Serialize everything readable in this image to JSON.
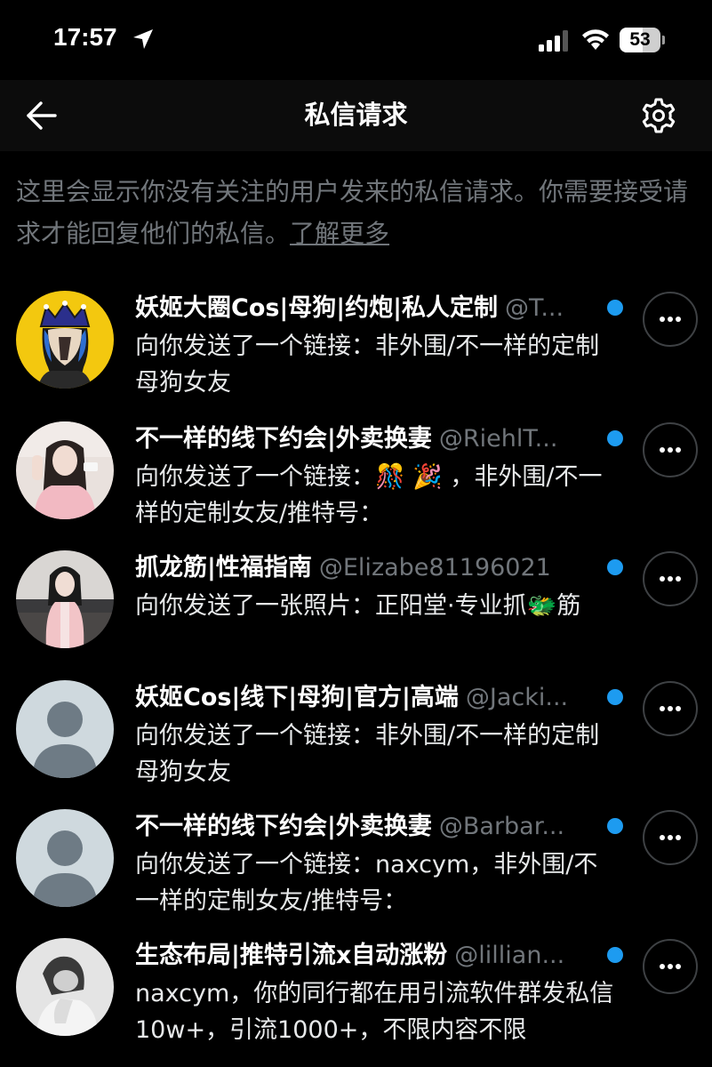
{
  "status_bar": {
    "time": "17:57",
    "battery": "53"
  },
  "nav": {
    "title": "私信请求"
  },
  "info": {
    "text": "这里会显示你没有关注的用户发来的私信请求。你需要接受请求才能回复他们的私信。",
    "learn_more": "了解更多"
  },
  "colors": {
    "background": "#000000",
    "nav_background": "#0c0c0c",
    "accent_dot": "#1d9bf0",
    "secondary_text": "#71767b"
  },
  "requests": [
    {
      "name": "妖姬大圈Cos|母狗|约炮|私人定制",
      "handle": "@T...",
      "preview": "向你发送了一个链接：非外围/不一样的定制母狗女友",
      "unread": true,
      "avatar": "crown-cartoon-avatar"
    },
    {
      "name": "不一样的线下约会|外卖换妻",
      "handle": "@RiehlT...",
      "preview": "向你发送了一个链接：🎊 🎉 ，非外围/不一样的定制女友/推特号：",
      "unread": true,
      "avatar": "photo-avatar"
    },
    {
      "name": "抓龙筋|性福指南",
      "handle": "@Elizabe81196021",
      "preview": "向你发送了一张照片：正阳堂·专业抓🐲筋",
      "unread": true,
      "avatar": "photo-avatar"
    },
    {
      "name": "妖姬Cos|线下|母狗|官方|高端",
      "handle": "@Jacki...",
      "preview": "向你发送了一个链接：非外围/不一样的定制母狗女友",
      "unread": true,
      "avatar": "default-avatar"
    },
    {
      "name": "不一样的线下约会|外卖换妻",
      "handle": "@Barbar...",
      "preview": "向你发送了一个链接：naxcym，非外围/不一样的定制女友/推特号：",
      "unread": true,
      "avatar": "default-avatar"
    },
    {
      "name": "生态布局|推特引流x自动涨粉",
      "handle": "@lillian...",
      "preview": "naxcym，你的同行都在用引流软件群发私信10w+，引流1000+，不限内容不限",
      "unread": true,
      "avatar": "grayscale-photo-avatar"
    }
  ]
}
